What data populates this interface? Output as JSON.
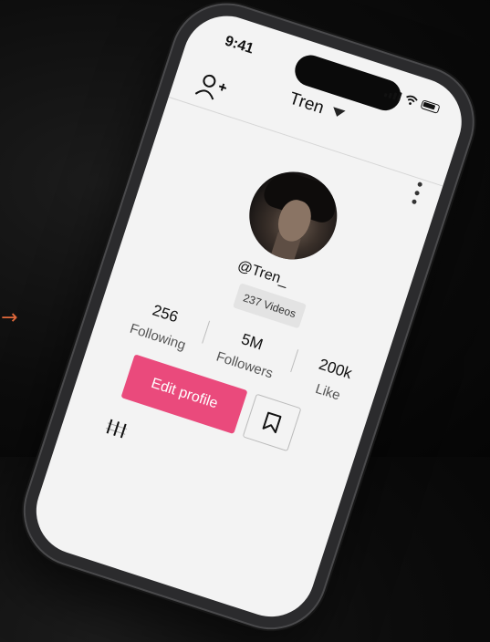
{
  "status_bar": {
    "time": "9:41"
  },
  "header": {
    "username": "Tren",
    "add_friend_icon": "add-user-icon",
    "menu_icon": "more-vertical-icon"
  },
  "profile": {
    "handle": "@Tren_",
    "videos_badge": "237 Videos",
    "stats": [
      {
        "value": "256",
        "label": "Following"
      },
      {
        "value": "5M",
        "label": "Followers"
      },
      {
        "value": "200k",
        "label": "Like"
      }
    ],
    "edit_label": "Edit profile"
  },
  "colors": {
    "accent": "#ea4a7c",
    "decor_arrow": "#e0683a"
  },
  "decor": {
    "arrow_glyph": "→"
  }
}
